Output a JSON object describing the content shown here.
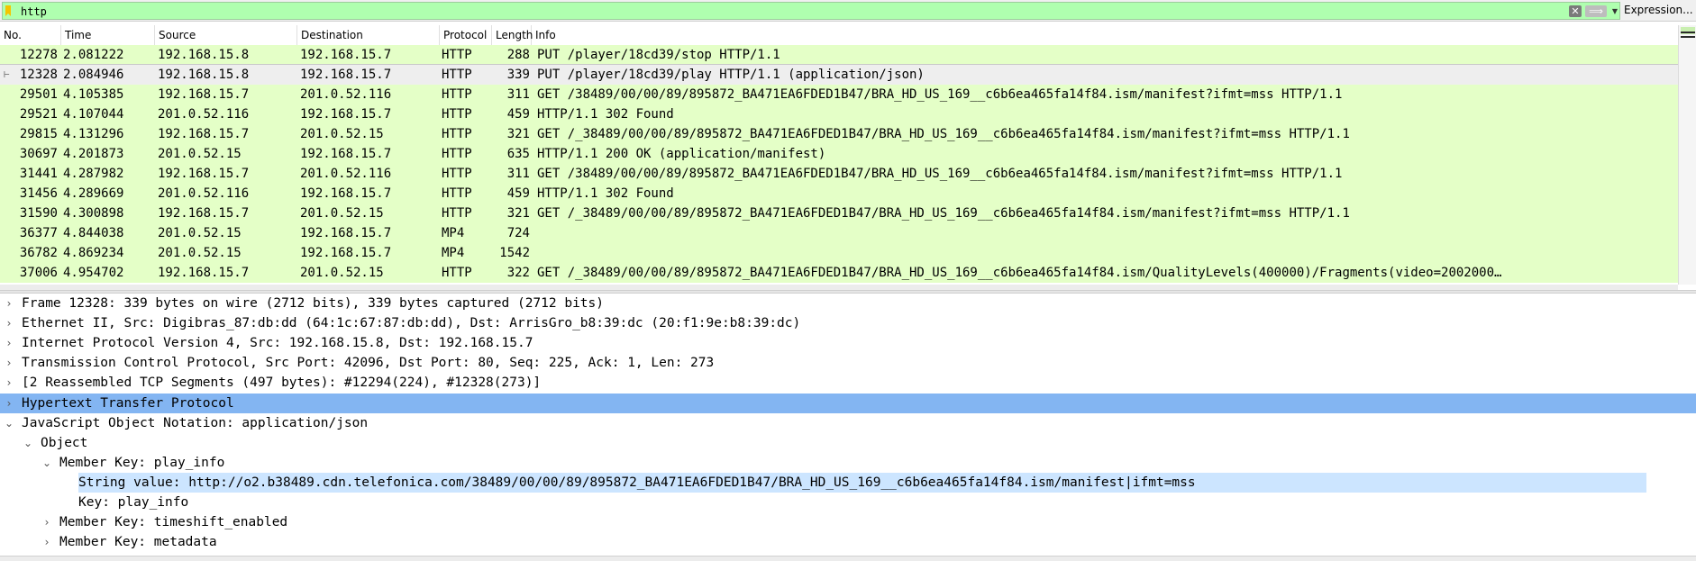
{
  "filter": {
    "value": "http",
    "clear_icon": "clear-icon",
    "apply_icon": "arrow-right-icon",
    "expression_label": "Expression..."
  },
  "columns": [
    {
      "key": "no",
      "label": "No."
    },
    {
      "key": "time",
      "label": "Time"
    },
    {
      "key": "source",
      "label": "Source"
    },
    {
      "key": "destination",
      "label": "Destination"
    },
    {
      "key": "protocol",
      "label": "Protocol"
    },
    {
      "key": "length",
      "label": "Length"
    },
    {
      "key": "info",
      "label": "Info"
    }
  ],
  "packets": [
    {
      "no": "12278",
      "time": "2.081222",
      "source": "192.168.15.8",
      "destination": "192.168.15.7",
      "protocol": "HTTP",
      "length": "288",
      "info": "PUT /player/18cd39/stop HTTP/1.1"
    },
    {
      "no": "12328",
      "time": "2.084946",
      "source": "192.168.15.8",
      "destination": "192.168.15.7",
      "protocol": "HTTP",
      "length": "339",
      "info": "PUT /player/18cd39/play HTTP/1.1  (application/json)",
      "selected": true
    },
    {
      "no": "29501",
      "time": "4.105385",
      "source": "192.168.15.7",
      "destination": "201.0.52.116",
      "protocol": "HTTP",
      "length": "311",
      "info": "GET /38489/00/00/89/895872_BA471EA6FDED1B47/BRA_HD_US_169__c6b6ea465fa14f84.ism/manifest?ifmt=mss HTTP/1.1"
    },
    {
      "no": "29521",
      "time": "4.107044",
      "source": "201.0.52.116",
      "destination": "192.168.15.7",
      "protocol": "HTTP",
      "length": "459",
      "info": "HTTP/1.1 302 Found"
    },
    {
      "no": "29815",
      "time": "4.131296",
      "source": "192.168.15.7",
      "destination": "201.0.52.15",
      "protocol": "HTTP",
      "length": "321",
      "info": "GET /_38489/00/00/89/895872_BA471EA6FDED1B47/BRA_HD_US_169__c6b6ea465fa14f84.ism/manifest?ifmt=mss HTTP/1.1"
    },
    {
      "no": "30697",
      "time": "4.201873",
      "source": "201.0.52.15",
      "destination": "192.168.15.7",
      "protocol": "HTTP",
      "length": "635",
      "info": "HTTP/1.1 200 OK  (application/manifest)"
    },
    {
      "no": "31441",
      "time": "4.287982",
      "source": "192.168.15.7",
      "destination": "201.0.52.116",
      "protocol": "HTTP",
      "length": "311",
      "info": "GET /38489/00/00/89/895872_BA471EA6FDED1B47/BRA_HD_US_169__c6b6ea465fa14f84.ism/manifest?ifmt=mss HTTP/1.1"
    },
    {
      "no": "31456",
      "time": "4.289669",
      "source": "201.0.52.116",
      "destination": "192.168.15.7",
      "protocol": "HTTP",
      "length": "459",
      "info": "HTTP/1.1 302 Found"
    },
    {
      "no": "31590",
      "time": "4.300898",
      "source": "192.168.15.7",
      "destination": "201.0.52.15",
      "protocol": "HTTP",
      "length": "321",
      "info": "GET /_38489/00/00/89/895872_BA471EA6FDED1B47/BRA_HD_US_169__c6b6ea465fa14f84.ism/manifest?ifmt=mss HTTP/1.1"
    },
    {
      "no": "36377",
      "time": "4.844038",
      "source": "201.0.52.15",
      "destination": "192.168.15.7",
      "protocol": "MP4",
      "length": "724",
      "info": ""
    },
    {
      "no": "36782",
      "time": "4.869234",
      "source": "201.0.52.15",
      "destination": "192.168.15.7",
      "protocol": "MP4",
      "length": "1542",
      "info": ""
    },
    {
      "no": "37006",
      "time": "4.954702",
      "source": "192.168.15.7",
      "destination": "201.0.52.15",
      "protocol": "HTTP",
      "length": "322",
      "info": "GET /_38489/00/00/89/895872_BA471EA6FDED1B47/BRA_HD_US_169__c6b6ea465fa14f84.ism/QualityLevels(400000)/Fragments(video=2002000…"
    }
  ],
  "details": [
    {
      "level": 0,
      "toggle": "collapsed",
      "label": "Frame 12328: 339 bytes on wire (2712 bits), 339 bytes captured (2712 bits)"
    },
    {
      "level": 0,
      "toggle": "collapsed",
      "label": "Ethernet II, Src: Digibras_87:db:dd (64:1c:67:87:db:dd), Dst: ArrisGro_b8:39:dc (20:f1:9e:b8:39:dc)"
    },
    {
      "level": 0,
      "toggle": "collapsed",
      "label": "Internet Protocol Version 4, Src: 192.168.15.8, Dst: 192.168.15.7"
    },
    {
      "level": 0,
      "toggle": "collapsed",
      "label": "Transmission Control Protocol, Src Port: 42096, Dst Port: 80, Seq: 225, Ack: 1, Len: 273"
    },
    {
      "level": 0,
      "toggle": "collapsed",
      "label": "[2 Reassembled TCP Segments (497 bytes): #12294(224), #12328(273)]"
    },
    {
      "level": 0,
      "toggle": "collapsed",
      "label": "Hypertext Transfer Protocol",
      "highlight": "strong"
    },
    {
      "level": 0,
      "toggle": "expanded",
      "label": "JavaScript Object Notation: application/json"
    },
    {
      "level": 1,
      "toggle": "expanded",
      "label": "Object"
    },
    {
      "level": 2,
      "toggle": "expanded",
      "label": "Member Key: play_info"
    },
    {
      "level": 3,
      "toggle": "none",
      "label": "String value: http://o2.b38489.cdn.telefonica.com/38489/00/00/89/895872_BA471EA6FDED1B47/BRA_HD_US_169__c6b6ea465fa14f84.ism/manifest|ifmt=mss",
      "highlight": "light"
    },
    {
      "level": 3,
      "toggle": "none",
      "label": "Key: play_info"
    },
    {
      "level": 2,
      "toggle": "collapsed",
      "label": "Member Key: timeshift_enabled"
    },
    {
      "level": 2,
      "toggle": "collapsed",
      "label": "Member Key: metadata"
    }
  ],
  "colors": {
    "http_row": "#e4ffc7",
    "selected_row": "#eeeeee",
    "filter_valid": "#afffaf",
    "tree_highlight": "#83b5f2",
    "tree_value_highlight": "#cce5ff"
  }
}
